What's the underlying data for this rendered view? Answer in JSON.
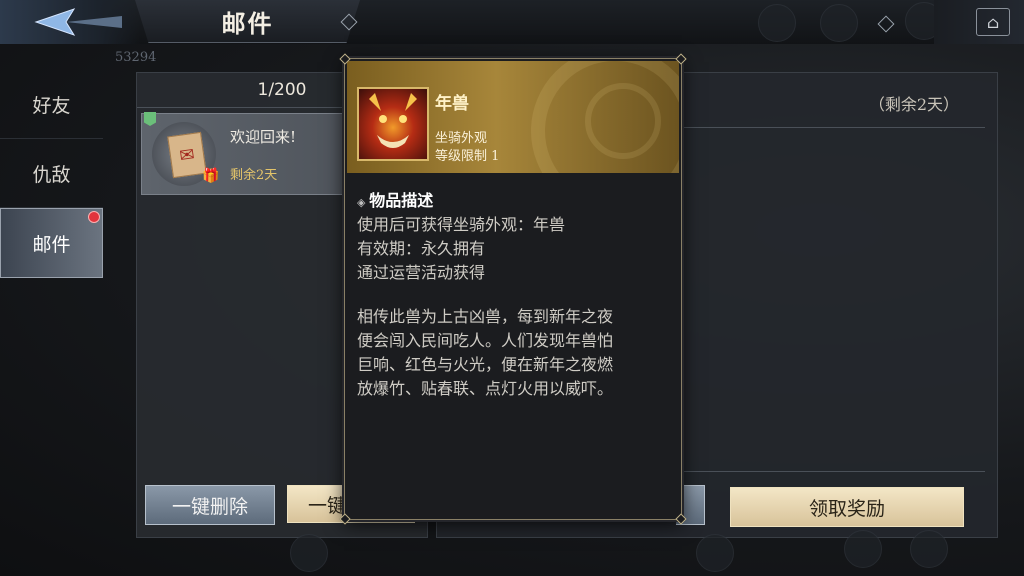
{
  "header": {
    "title": "邮件",
    "counter": "53294"
  },
  "tabs": [
    {
      "label": "好友"
    },
    {
      "label": "仇敌"
    },
    {
      "label": "邮件"
    }
  ],
  "mail_list": {
    "count": "1/200",
    "items": [
      {
        "title": "欢迎回来!",
        "remaining": "剩余2天",
        "icon": "letter-icon"
      }
    ],
    "delete_all_label": "一键删除",
    "claim_all_label": "一键"
  },
  "mail_detail": {
    "remaining": "（剩余2天）",
    "claim_button_label": "领取奖励"
  },
  "tooltip": {
    "item_name": "年兽",
    "item_type": "坐骑外观",
    "item_level": "等级限制 1",
    "desc_header": "物品描述",
    "lines": [
      "使用后可获得坐骑外观：年兽",
      "有效期：永久拥有",
      "通过运营活动获得",
      "",
      "相传此兽为上古凶兽，每到新年之夜",
      "便会闯入民间吃人。人们发现年兽怕",
      "巨响、红色与火光，便在新年之夜燃",
      "放爆竹、贴春联、点灯火用以威吓。"
    ]
  },
  "colors": {
    "accent_gold": "#d8b86a",
    "unread": "#e2343c"
  }
}
